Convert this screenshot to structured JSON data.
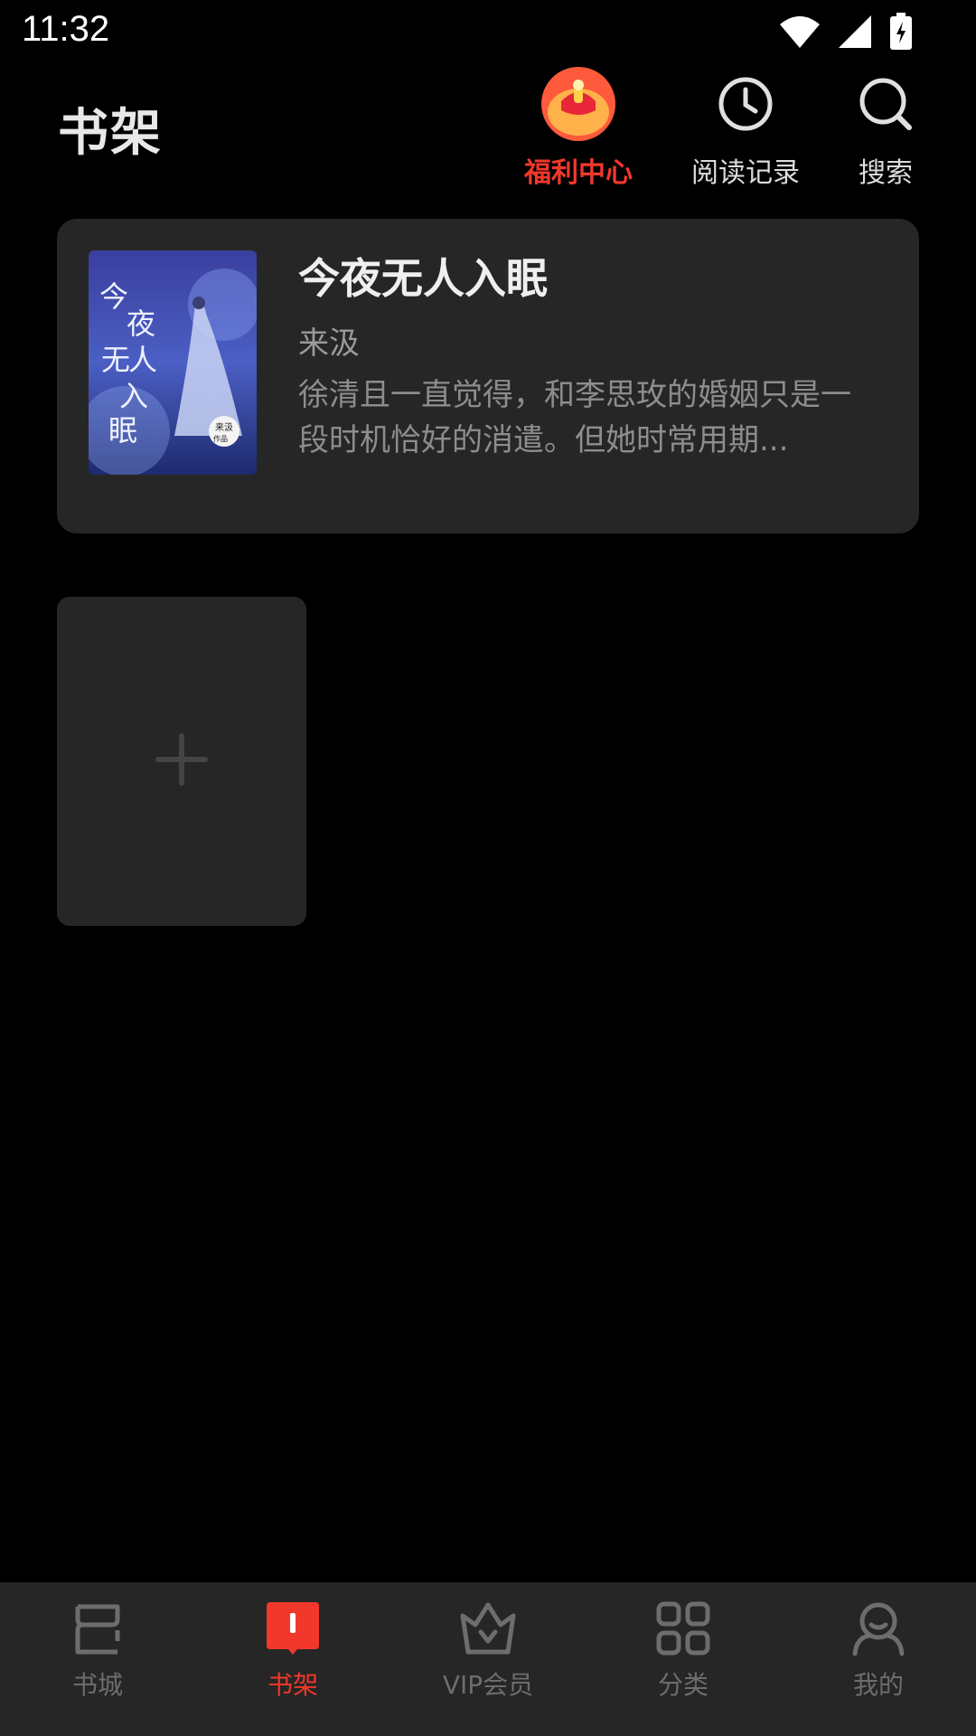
{
  "status_bar": {
    "time": "11:32",
    "icons": [
      "wifi-icon",
      "signal-icon",
      "battery-charging-icon"
    ]
  },
  "header": {
    "title": "书架",
    "actions": [
      {
        "label": "福利中心",
        "icon": "gift-icon",
        "color": "#f2382b"
      },
      {
        "label": "阅读记录",
        "icon": "clock-icon"
      },
      {
        "label": "搜索",
        "icon": "search-icon"
      }
    ]
  },
  "book": {
    "title": "今夜无人入眠",
    "author": "来汲",
    "description": "徐清且一直觉得，和李思玫的婚姻只是一段时机恰好的消遣。但她时常用期...",
    "cover_text": "今夜无人入眠",
    "cover_badge": "来汲作品"
  },
  "add_tile": {
    "icon": "plus-icon"
  },
  "bottom_nav": {
    "items": [
      {
        "label": "书城",
        "icon": "bookstore-icon",
        "active": false
      },
      {
        "label": "书架",
        "icon": "bookshelf-icon",
        "active": true
      },
      {
        "label": "VIP会员",
        "icon": "crown-icon",
        "active": false
      },
      {
        "label": "分类",
        "icon": "grid-icon",
        "active": false
      },
      {
        "label": "我的",
        "icon": "profile-icon",
        "active": false
      }
    ]
  },
  "colors": {
    "accent": "#f2382b",
    "background": "#000000",
    "card": "#262626"
  }
}
